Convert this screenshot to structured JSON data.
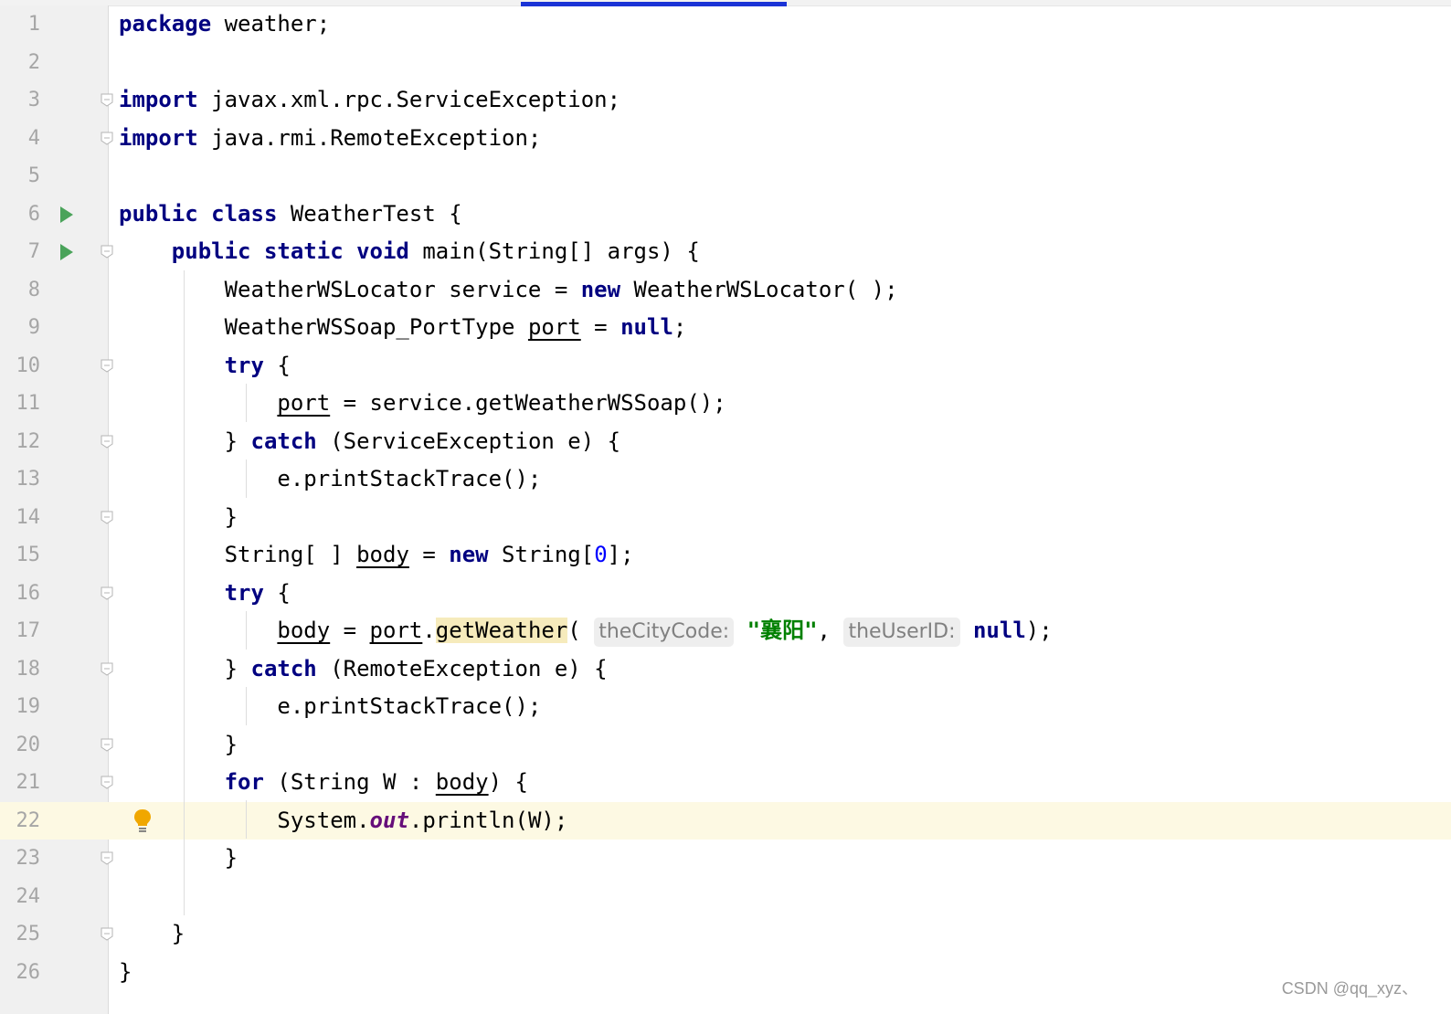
{
  "editor": {
    "current_line": 22,
    "lines": [
      {
        "n": "1",
        "tokens": [
          {
            "t": "package",
            "c": "kw"
          },
          {
            "t": " weather;"
          }
        ]
      },
      {
        "n": "2",
        "tokens": []
      },
      {
        "n": "3",
        "fold": true,
        "tokens": [
          {
            "t": "import",
            "c": "kw"
          },
          {
            "t": " javax.xml.rpc.ServiceException;"
          }
        ]
      },
      {
        "n": "4",
        "fold": true,
        "tokens": [
          {
            "t": "import",
            "c": "kw"
          },
          {
            "t": " java.rmi.RemoteException;"
          }
        ]
      },
      {
        "n": "5",
        "tokens": []
      },
      {
        "n": "6",
        "run": true,
        "tokens": [
          {
            "t": "public class",
            "c": "kw"
          },
          {
            "t": " WeatherTest {"
          }
        ]
      },
      {
        "n": "7",
        "run": true,
        "fold": true,
        "tokens": [
          {
            "t": "    "
          },
          {
            "t": "public static void",
            "c": "kw"
          },
          {
            "t": " main(String[] args) {"
          }
        ]
      },
      {
        "n": "8",
        "tokens": [
          {
            "t": "        WeatherWSLocator service = "
          },
          {
            "t": "new",
            "c": "kw"
          },
          {
            "t": " WeatherWSLocator( );"
          }
        ]
      },
      {
        "n": "9",
        "tokens": [
          {
            "t": "        WeatherWSSoap_PortType "
          },
          {
            "t": "port",
            "c": "ul"
          },
          {
            "t": " = "
          },
          {
            "t": "null",
            "c": "kw"
          },
          {
            "t": ";"
          }
        ]
      },
      {
        "n": "10",
        "fold": true,
        "tokens": [
          {
            "t": "        "
          },
          {
            "t": "try",
            "c": "kw"
          },
          {
            "t": " {"
          }
        ]
      },
      {
        "n": "11",
        "tokens": [
          {
            "t": "            "
          },
          {
            "t": "port",
            "c": "ul"
          },
          {
            "t": " = service.getWeatherWSSoap();"
          }
        ]
      },
      {
        "n": "12",
        "fold": true,
        "tokens": [
          {
            "t": "        } "
          },
          {
            "t": "catch",
            "c": "kw"
          },
          {
            "t": " (ServiceException e) {"
          }
        ]
      },
      {
        "n": "13",
        "tokens": [
          {
            "t": "            e.printStackTrace();"
          }
        ]
      },
      {
        "n": "14",
        "fold": true,
        "tokens": [
          {
            "t": "        }"
          }
        ]
      },
      {
        "n": "15",
        "tokens": [
          {
            "t": "        String[ ] "
          },
          {
            "t": "body",
            "c": "ul"
          },
          {
            "t": " = "
          },
          {
            "t": "new",
            "c": "kw"
          },
          {
            "t": " String["
          },
          {
            "t": "0",
            "c": "num"
          },
          {
            "t": "];"
          }
        ]
      },
      {
        "n": "16",
        "fold": true,
        "tokens": [
          {
            "t": "        "
          },
          {
            "t": "try",
            "c": "kw"
          },
          {
            "t": " {"
          }
        ]
      },
      {
        "n": "17",
        "tokens": [
          {
            "t": "            "
          },
          {
            "t": "body",
            "c": "ul"
          },
          {
            "t": " = "
          },
          {
            "t": "port",
            "c": "ul"
          },
          {
            "t": "."
          },
          {
            "t": "getWeather",
            "c": "hl-method"
          },
          {
            "t": "( "
          },
          {
            "t": "theCityCode:",
            "c": "hint"
          },
          {
            "t": " "
          },
          {
            "t": "\"襄阳\"",
            "c": "str"
          },
          {
            "t": ", "
          },
          {
            "t": "theUserID:",
            "c": "hint"
          },
          {
            "t": " "
          },
          {
            "t": "null",
            "c": "kw"
          },
          {
            "t": ");"
          }
        ]
      },
      {
        "n": "18",
        "fold": true,
        "tokens": [
          {
            "t": "        } "
          },
          {
            "t": "catch",
            "c": "kw"
          },
          {
            "t": " (RemoteException e) {"
          }
        ]
      },
      {
        "n": "19",
        "tokens": [
          {
            "t": "            e.printStackTrace();"
          }
        ]
      },
      {
        "n": "20",
        "fold": true,
        "tokens": [
          {
            "t": "        }"
          }
        ]
      },
      {
        "n": "21",
        "fold": true,
        "tokens": [
          {
            "t": "        "
          },
          {
            "t": "for",
            "c": "kw"
          },
          {
            "t": " (String W : "
          },
          {
            "t": "body",
            "c": "ul"
          },
          {
            "t": ") {"
          }
        ]
      },
      {
        "n": "22",
        "bulb": true,
        "tokens": [
          {
            "t": "            System."
          },
          {
            "t": "out",
            "c": "field"
          },
          {
            "t": ".println(W);"
          }
        ]
      },
      {
        "n": "23",
        "fold": true,
        "tokens": [
          {
            "t": "        }"
          }
        ]
      },
      {
        "n": "24",
        "tokens": []
      },
      {
        "n": "25",
        "fold": true,
        "tokens": [
          {
            "t": "    }"
          }
        ]
      },
      {
        "n": "26",
        "tokens": [
          {
            "t": "}"
          }
        ]
      }
    ]
  },
  "icons": {
    "run": "run-triangle-icon",
    "fold": "fold-marker-icon",
    "bulb": "lightbulb-icon"
  },
  "colors": {
    "keyword": "#000080",
    "number": "#0000ff",
    "string": "#008000",
    "field": "#660e7a",
    "current_line": "#fdf9e3",
    "gutter": "#f0f0f0",
    "scrollbar_thumb": "#1a33d6"
  },
  "watermark": "CSDN @qq_xyz、"
}
